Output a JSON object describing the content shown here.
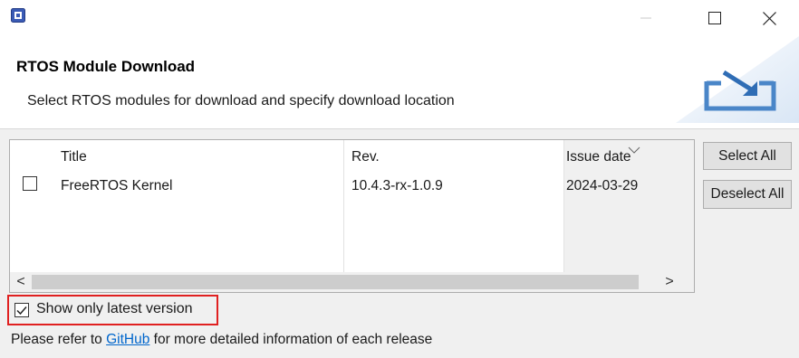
{
  "window": {
    "icon": "renesas-chip-icon",
    "controls": {
      "minimize_icon": "minimize-icon",
      "maximize_icon": "maximize-icon",
      "close_icon": "close-icon"
    }
  },
  "header": {
    "title": "RTOS Module Download",
    "description": "Select RTOS modules for download and specify download location",
    "graphic_icon": "download-tray-icon"
  },
  "table": {
    "columns": [
      "Title",
      "Rev.",
      "Issue date"
    ],
    "sorted_column": "Issue date",
    "sort_icon": "sort-descending-icon",
    "rows": [
      {
        "checked": false,
        "title": "FreeRTOS Kernel",
        "rev": "10.4.3-rx-1.0.9",
        "issue_date": "2024-03-29"
      }
    ],
    "scroll_left_label": "<",
    "scroll_right_label": ">"
  },
  "buttons": {
    "select_all": "Select All",
    "deselect_all": "Deselect All"
  },
  "options": {
    "show_latest_label": "Show only latest version",
    "show_latest_checked": true
  },
  "footer": {
    "text_before": "Please refer to ",
    "link_text": "GitHub",
    "text_after": " for more detailed information of each release"
  },
  "colors": {
    "highlight_border": "#e02020",
    "link": "#0066cc",
    "panel_bg": "#f0f0f0"
  }
}
